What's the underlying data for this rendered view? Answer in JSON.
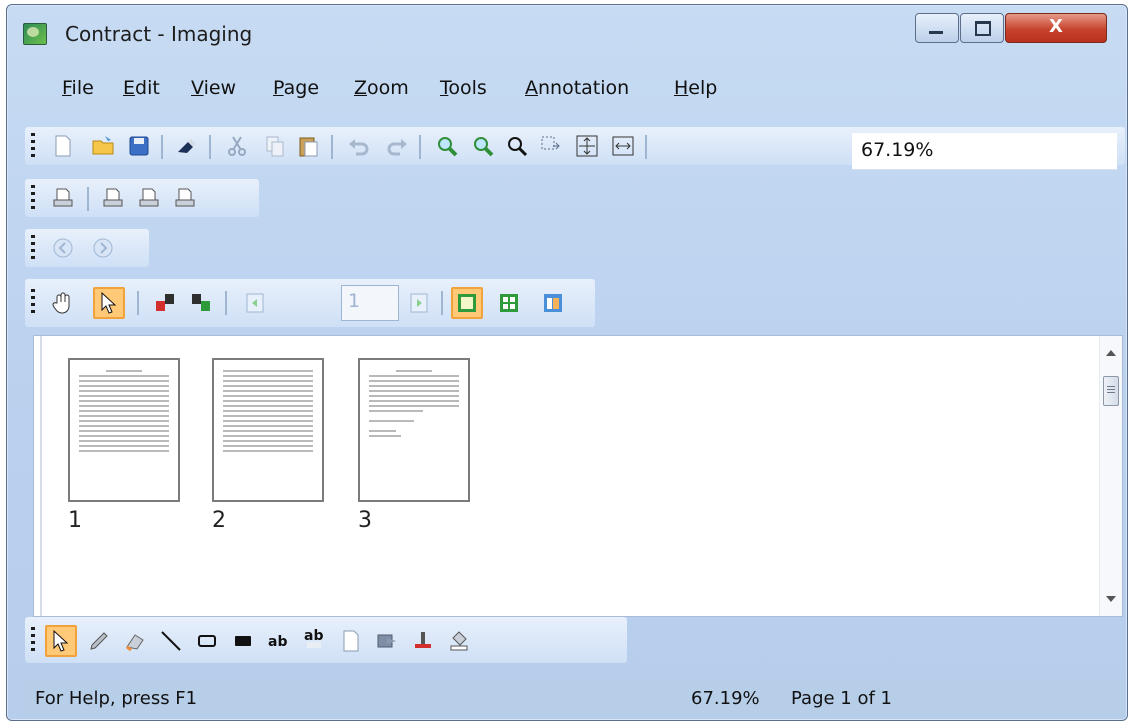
{
  "window": {
    "title": "Contract - Imaging",
    "close_glyph": "X"
  },
  "menu": [
    {
      "label": "File",
      "u": "F",
      "rest": "ile"
    },
    {
      "label": "Edit",
      "u": "E",
      "rest": "dit"
    },
    {
      "label": "View",
      "u": "V",
      "rest": "iew"
    },
    {
      "label": "Page",
      "u": "P",
      "rest": "age"
    },
    {
      "label": "Zoom",
      "u": "Z",
      "rest": "oom"
    },
    {
      "label": "Tools",
      "u": "T",
      "rest": "ools"
    },
    {
      "label": "Annotation",
      "u": "A",
      "rest": "nnotation"
    },
    {
      "label": "Help",
      "u": "H",
      "rest": "elp"
    }
  ],
  "toolbar": {
    "zoom_value": "67.19%"
  },
  "page_toolbar": {
    "page_number": "1"
  },
  "thumbnails": [
    {
      "label": "1"
    },
    {
      "label": "2"
    },
    {
      "label": "3"
    }
  ],
  "status": {
    "help": "For Help, press F1",
    "zoom": "67.19%",
    "page": "Page 1 of 1"
  },
  "colors": {
    "accent": "#ffc978",
    "accent_border": "#f2a23b",
    "toolbar_bg": "#cfe0f6",
    "window_bg": "#b9d0ee"
  }
}
